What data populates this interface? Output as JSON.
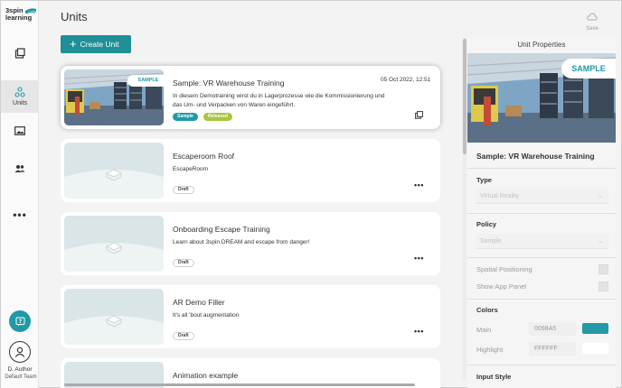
{
  "sidebar": {
    "logo_line1": "3spin",
    "logo_line2": "learning",
    "units_label": "Units",
    "more_label": "•••",
    "user_name": "D. Author",
    "team_name": "Default Team"
  },
  "header": {
    "title": "Units",
    "save_label": "Save",
    "create_label": "Create Unit"
  },
  "units": [
    {
      "title": "Sample: VR Warehouse Training",
      "description": "In diesem Demotraining wirst du in Lagerprozesse wie die Kommissionierung und das Um- und Verpacken von Waren eingeführt.",
      "date": "05 Oct 2022, 12:51",
      "sample_tag": "SAMPLE",
      "badge1": "Sample",
      "badge2": "Released"
    },
    {
      "title": "Escaperoom Roof",
      "description": "EscapeRoom",
      "badge1": "Draft",
      "more": "•••"
    },
    {
      "title": "Onboarding Escape Training",
      "description": "Learn about 3spin DREAM and escape from danger!",
      "badge1": "Draft",
      "more": "•••"
    },
    {
      "title": "AR Demo Filler",
      "description": "It's all 'bout augmentation",
      "badge1": "Draft",
      "more": "•••"
    },
    {
      "title": "Animation example"
    }
  ],
  "properties": {
    "panel_title": "Unit Properties",
    "sample_tag": "SAMPLE",
    "unit_name": "Sample: VR Warehouse Training",
    "type_label": "Type",
    "type_value": "Virtual Reality",
    "policy_label": "Policy",
    "policy_value": "Sample",
    "spatial_label": "Spatial Positioning",
    "app_panel_label": "Show App Panel",
    "colors_label": "Colors",
    "main_label": "Main",
    "main_value": "0098A5",
    "highlight_label": "Highlight",
    "highlight_value": "FFFFFF",
    "input_style_label": "Input Style"
  },
  "colors": {
    "accent": "#1f8f97",
    "main_swatch": "#2299a4",
    "highlight_swatch": "#ffffff",
    "released": "#a8c63c"
  },
  "icons": [
    "units-grid-icon",
    "molecule-icon",
    "image-icon",
    "users-icon",
    "help-icon",
    "avatar-icon",
    "cloud-icon",
    "copy-icon",
    "chevron-down-icon"
  ]
}
